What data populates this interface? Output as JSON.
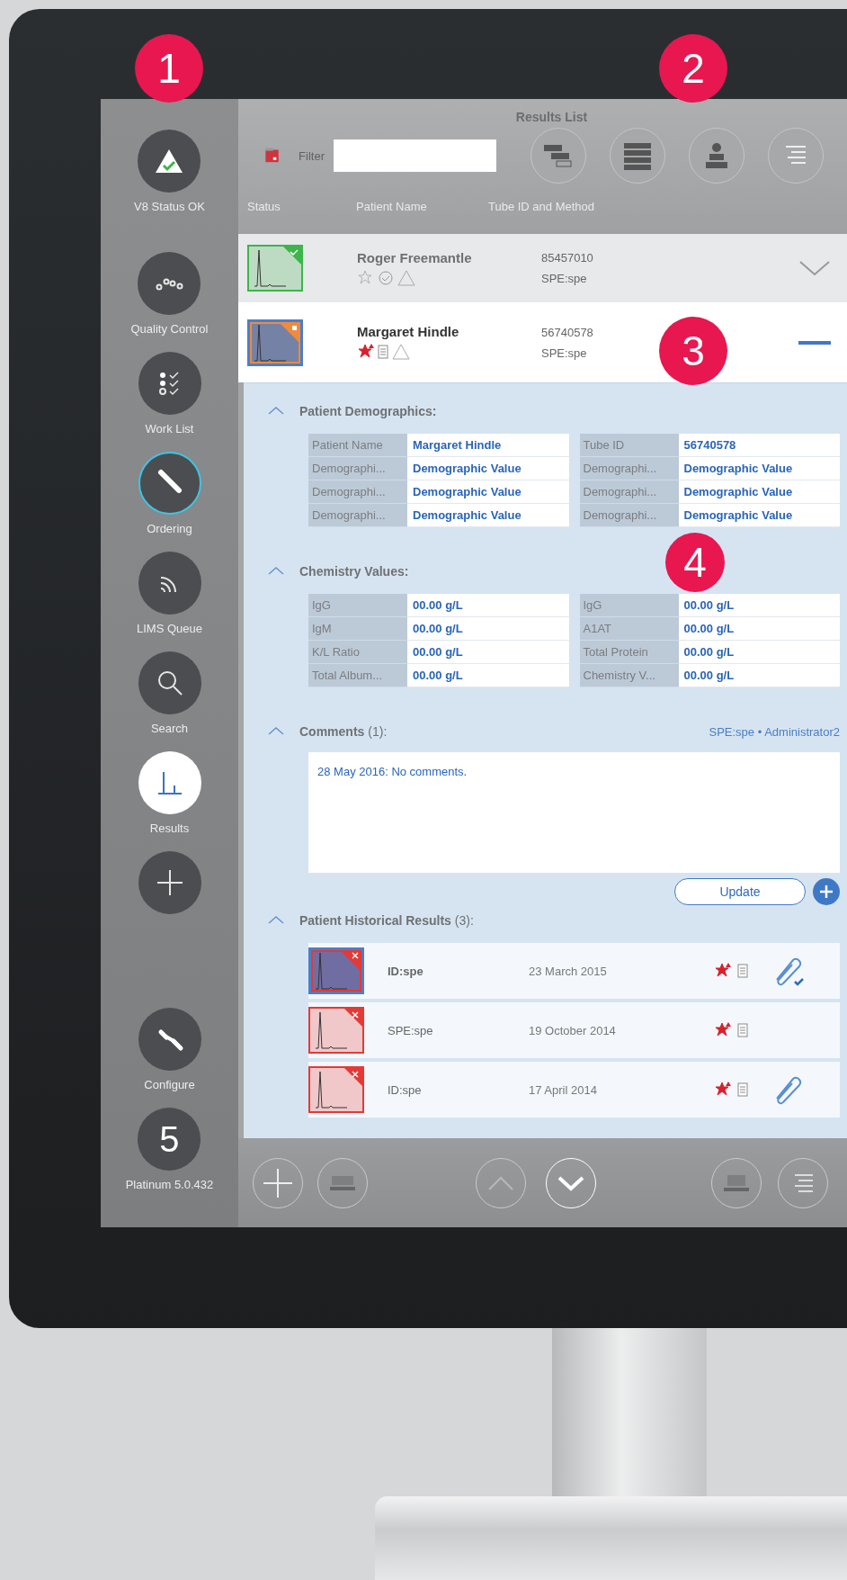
{
  "badges": [
    "1",
    "2",
    "3",
    "4"
  ],
  "sidebar": {
    "items": [
      {
        "kind": "status",
        "label": "V8 Status OK",
        "selected": false,
        "focused": false
      },
      {
        "kind": "qc",
        "label": "Quality Control",
        "selected": false,
        "focused": false
      },
      {
        "kind": "worklist",
        "label": "Work List",
        "selected": false,
        "focused": false
      },
      {
        "kind": "ordering",
        "label": "Ordering",
        "selected": false,
        "focused": true
      },
      {
        "kind": "lims",
        "label": "LIMS Queue",
        "selected": false,
        "focused": false
      },
      {
        "kind": "search",
        "label": "Search",
        "selected": false,
        "focused": false
      },
      {
        "kind": "results",
        "label": "Results",
        "selected": true,
        "focused": false
      },
      {
        "kind": "add",
        "selected": false,
        "focused": false
      }
    ],
    "bottom_items": [
      {
        "kind": "configure",
        "label": "Configure",
        "selected": false,
        "focused": false
      },
      {
        "kind": "version",
        "symbol": "5",
        "label": "Platinum 5.0.432",
        "selected": false,
        "focused": false
      }
    ]
  },
  "results_list": {
    "title": "Results List",
    "filter": {
      "label": "Filter"
    },
    "columns": [
      "Status",
      "Patient Name",
      "Tube ID and Method"
    ],
    "rows": [
      {
        "name": "Roger Freemantle",
        "tube_id": "85457010",
        "method": "SPE:spe",
        "color": "#3cb54a",
        "kind": "check",
        "flagged": false,
        "selected": false,
        "expanded": false
      },
      {
        "name": "Margaret Hindle",
        "tube_id": "56740578",
        "method": "SPE:spe",
        "color": "#f08a3c",
        "kind": "dot",
        "flagged": true,
        "selected": true,
        "expanded": true
      }
    ]
  },
  "details": {
    "demographics": {
      "title": "Patient Demographics:",
      "expanded": true,
      "columns": [
        [
          {
            "label": "Patient Name",
            "value": "Margaret Hindle"
          },
          {
            "label": "Demographi...",
            "value": "Demographic Value"
          },
          {
            "label": "Demographi...",
            "value": "Demographic Value"
          },
          {
            "label": "Demographi...",
            "value": "Demographic Value"
          }
        ],
        [
          {
            "label": "Tube ID",
            "value": "56740578"
          },
          {
            "label": "Demographi...",
            "value": "Demographic Value"
          },
          {
            "label": "Demographi...",
            "value": "Demographic Value"
          },
          {
            "label": "Demographi...",
            "value": "Demographic Value"
          }
        ]
      ]
    },
    "chemistry": {
      "title": "Chemistry Values:",
      "expanded": true,
      "columns": [
        [
          {
            "label": "IgG",
            "value": "00.00 g/L"
          },
          {
            "label": "IgM",
            "value": "00.00 g/L"
          },
          {
            "label": "K/L Ratio",
            "value": "00.00 g/L"
          },
          {
            "label": "Total Album...",
            "value": "00.00 g/L"
          }
        ],
        [
          {
            "label": "IgG",
            "value": "00.00 g/L"
          },
          {
            "label": "A1AT",
            "value": "00.00 g/L"
          },
          {
            "label": "Total Protein",
            "value": "00.00 g/L"
          },
          {
            "label": "Chemistry V...",
            "value": "00.00 g/L"
          }
        ]
      ]
    },
    "comments": {
      "title": "Comments",
      "count": "(1):",
      "expanded": true,
      "method": "SPE:spe",
      "separator": "•",
      "user": "Administrator2",
      "text": "28 May 2016: No comments.",
      "button": "Update"
    },
    "history": {
      "title": "Patient Historical Results",
      "count": "(3):",
      "expanded": true,
      "rows": [
        {
          "method": "ID:spe",
          "date": "23 March 2015",
          "color": "#e53935",
          "kind": "cross",
          "flagged": true,
          "selected": true,
          "attached": true,
          "attachment_confirmed": true
        },
        {
          "method": "SPE:spe",
          "date": "19 October 2014",
          "color": "#e53935",
          "kind": "cross",
          "flagged": true,
          "selected": false,
          "attached": false,
          "attachment_confirmed": false
        },
        {
          "method": "ID:spe",
          "date": "17 April 2014",
          "color": "#e53935",
          "kind": "cross",
          "flagged": true,
          "selected": false,
          "attached": true,
          "attachment_confirmed": false
        }
      ]
    }
  }
}
